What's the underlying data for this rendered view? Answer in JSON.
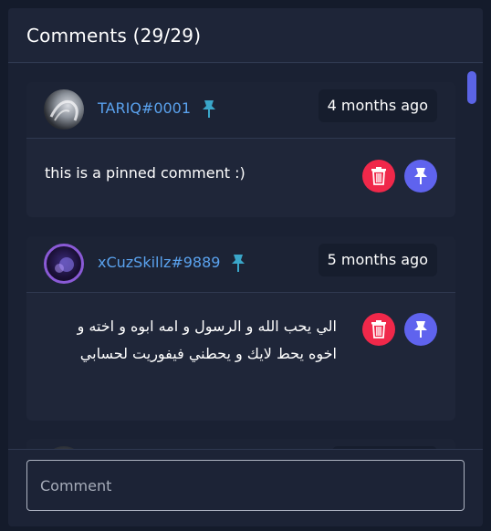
{
  "header": {
    "title": "Comments (29/29)"
  },
  "colors": {
    "username": "#5aa2ee",
    "delete_button": "#f0284a",
    "pin_button": "#5f63ee",
    "pin_icon": "#3aa6c9",
    "scrollbar": "#5b64e6"
  },
  "comments": [
    {
      "username": "TARIQ#0001",
      "pinned": true,
      "time": "4 months ago",
      "text": "this is a pinned comment :)",
      "avatar_icon": "avatar-icon",
      "actions": [
        "trash-icon",
        "pin-icon"
      ]
    },
    {
      "username": "xCuzSkillz#9889",
      "pinned": true,
      "time": "5 months ago",
      "text": "الي يحب الله و الرسول و امه ابوه و اخته و اخوه يحط لايك و يحطني فيفوريت لحسابي",
      "avatar_icon": "avatar-icon",
      "actions": [
        "trash-icon",
        "pin-icon"
      ]
    },
    {
      "username": "",
      "pinned": true,
      "time": "",
      "text": "",
      "avatar_icon": "avatar-icon"
    }
  ],
  "composer": {
    "placeholder": "Comment"
  }
}
